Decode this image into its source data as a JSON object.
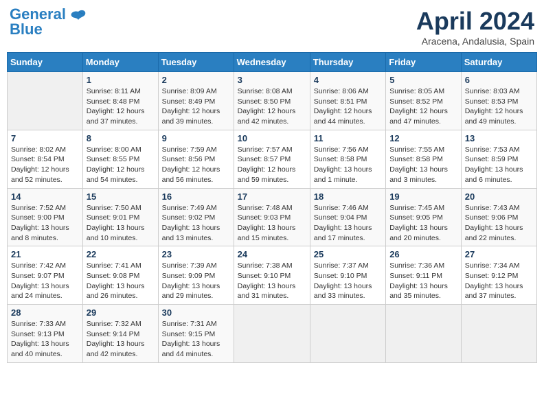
{
  "header": {
    "logo_general": "General",
    "logo_blue": "Blue",
    "month": "April 2024",
    "location": "Aracena, Andalusia, Spain"
  },
  "columns": [
    "Sunday",
    "Monday",
    "Tuesday",
    "Wednesday",
    "Thursday",
    "Friday",
    "Saturday"
  ],
  "weeks": [
    [
      {
        "day": "",
        "sunrise": "",
        "sunset": "",
        "daylight": ""
      },
      {
        "day": "1",
        "sunrise": "Sunrise: 8:11 AM",
        "sunset": "Sunset: 8:48 PM",
        "daylight": "Daylight: 12 hours and 37 minutes."
      },
      {
        "day": "2",
        "sunrise": "Sunrise: 8:09 AM",
        "sunset": "Sunset: 8:49 PM",
        "daylight": "Daylight: 12 hours and 39 minutes."
      },
      {
        "day": "3",
        "sunrise": "Sunrise: 8:08 AM",
        "sunset": "Sunset: 8:50 PM",
        "daylight": "Daylight: 12 hours and 42 minutes."
      },
      {
        "day": "4",
        "sunrise": "Sunrise: 8:06 AM",
        "sunset": "Sunset: 8:51 PM",
        "daylight": "Daylight: 12 hours and 44 minutes."
      },
      {
        "day": "5",
        "sunrise": "Sunrise: 8:05 AM",
        "sunset": "Sunset: 8:52 PM",
        "daylight": "Daylight: 12 hours and 47 minutes."
      },
      {
        "day": "6",
        "sunrise": "Sunrise: 8:03 AM",
        "sunset": "Sunset: 8:53 PM",
        "daylight": "Daylight: 12 hours and 49 minutes."
      }
    ],
    [
      {
        "day": "7",
        "sunrise": "Sunrise: 8:02 AM",
        "sunset": "Sunset: 8:54 PM",
        "daylight": "Daylight: 12 hours and 52 minutes."
      },
      {
        "day": "8",
        "sunrise": "Sunrise: 8:00 AM",
        "sunset": "Sunset: 8:55 PM",
        "daylight": "Daylight: 12 hours and 54 minutes."
      },
      {
        "day": "9",
        "sunrise": "Sunrise: 7:59 AM",
        "sunset": "Sunset: 8:56 PM",
        "daylight": "Daylight: 12 hours and 56 minutes."
      },
      {
        "day": "10",
        "sunrise": "Sunrise: 7:57 AM",
        "sunset": "Sunset: 8:57 PM",
        "daylight": "Daylight: 12 hours and 59 minutes."
      },
      {
        "day": "11",
        "sunrise": "Sunrise: 7:56 AM",
        "sunset": "Sunset: 8:58 PM",
        "daylight": "Daylight: 13 hours and 1 minute."
      },
      {
        "day": "12",
        "sunrise": "Sunrise: 7:55 AM",
        "sunset": "Sunset: 8:58 PM",
        "daylight": "Daylight: 13 hours and 3 minutes."
      },
      {
        "day": "13",
        "sunrise": "Sunrise: 7:53 AM",
        "sunset": "Sunset: 8:59 PM",
        "daylight": "Daylight: 13 hours and 6 minutes."
      }
    ],
    [
      {
        "day": "14",
        "sunrise": "Sunrise: 7:52 AM",
        "sunset": "Sunset: 9:00 PM",
        "daylight": "Daylight: 13 hours and 8 minutes."
      },
      {
        "day": "15",
        "sunrise": "Sunrise: 7:50 AM",
        "sunset": "Sunset: 9:01 PM",
        "daylight": "Daylight: 13 hours and 10 minutes."
      },
      {
        "day": "16",
        "sunrise": "Sunrise: 7:49 AM",
        "sunset": "Sunset: 9:02 PM",
        "daylight": "Daylight: 13 hours and 13 minutes."
      },
      {
        "day": "17",
        "sunrise": "Sunrise: 7:48 AM",
        "sunset": "Sunset: 9:03 PM",
        "daylight": "Daylight: 13 hours and 15 minutes."
      },
      {
        "day": "18",
        "sunrise": "Sunrise: 7:46 AM",
        "sunset": "Sunset: 9:04 PM",
        "daylight": "Daylight: 13 hours and 17 minutes."
      },
      {
        "day": "19",
        "sunrise": "Sunrise: 7:45 AM",
        "sunset": "Sunset: 9:05 PM",
        "daylight": "Daylight: 13 hours and 20 minutes."
      },
      {
        "day": "20",
        "sunrise": "Sunrise: 7:43 AM",
        "sunset": "Sunset: 9:06 PM",
        "daylight": "Daylight: 13 hours and 22 minutes."
      }
    ],
    [
      {
        "day": "21",
        "sunrise": "Sunrise: 7:42 AM",
        "sunset": "Sunset: 9:07 PM",
        "daylight": "Daylight: 13 hours and 24 minutes."
      },
      {
        "day": "22",
        "sunrise": "Sunrise: 7:41 AM",
        "sunset": "Sunset: 9:08 PM",
        "daylight": "Daylight: 13 hours and 26 minutes."
      },
      {
        "day": "23",
        "sunrise": "Sunrise: 7:39 AM",
        "sunset": "Sunset: 9:09 PM",
        "daylight": "Daylight: 13 hours and 29 minutes."
      },
      {
        "day": "24",
        "sunrise": "Sunrise: 7:38 AM",
        "sunset": "Sunset: 9:10 PM",
        "daylight": "Daylight: 13 hours and 31 minutes."
      },
      {
        "day": "25",
        "sunrise": "Sunrise: 7:37 AM",
        "sunset": "Sunset: 9:10 PM",
        "daylight": "Daylight: 13 hours and 33 minutes."
      },
      {
        "day": "26",
        "sunrise": "Sunrise: 7:36 AM",
        "sunset": "Sunset: 9:11 PM",
        "daylight": "Daylight: 13 hours and 35 minutes."
      },
      {
        "day": "27",
        "sunrise": "Sunrise: 7:34 AM",
        "sunset": "Sunset: 9:12 PM",
        "daylight": "Daylight: 13 hours and 37 minutes."
      }
    ],
    [
      {
        "day": "28",
        "sunrise": "Sunrise: 7:33 AM",
        "sunset": "Sunset: 9:13 PM",
        "daylight": "Daylight: 13 hours and 40 minutes."
      },
      {
        "day": "29",
        "sunrise": "Sunrise: 7:32 AM",
        "sunset": "Sunset: 9:14 PM",
        "daylight": "Daylight: 13 hours and 42 minutes."
      },
      {
        "day": "30",
        "sunrise": "Sunrise: 7:31 AM",
        "sunset": "Sunset: 9:15 PM",
        "daylight": "Daylight: 13 hours and 44 minutes."
      },
      {
        "day": "",
        "sunrise": "",
        "sunset": "",
        "daylight": ""
      },
      {
        "day": "",
        "sunrise": "",
        "sunset": "",
        "daylight": ""
      },
      {
        "day": "",
        "sunrise": "",
        "sunset": "",
        "daylight": ""
      },
      {
        "day": "",
        "sunrise": "",
        "sunset": "",
        "daylight": ""
      }
    ]
  ]
}
